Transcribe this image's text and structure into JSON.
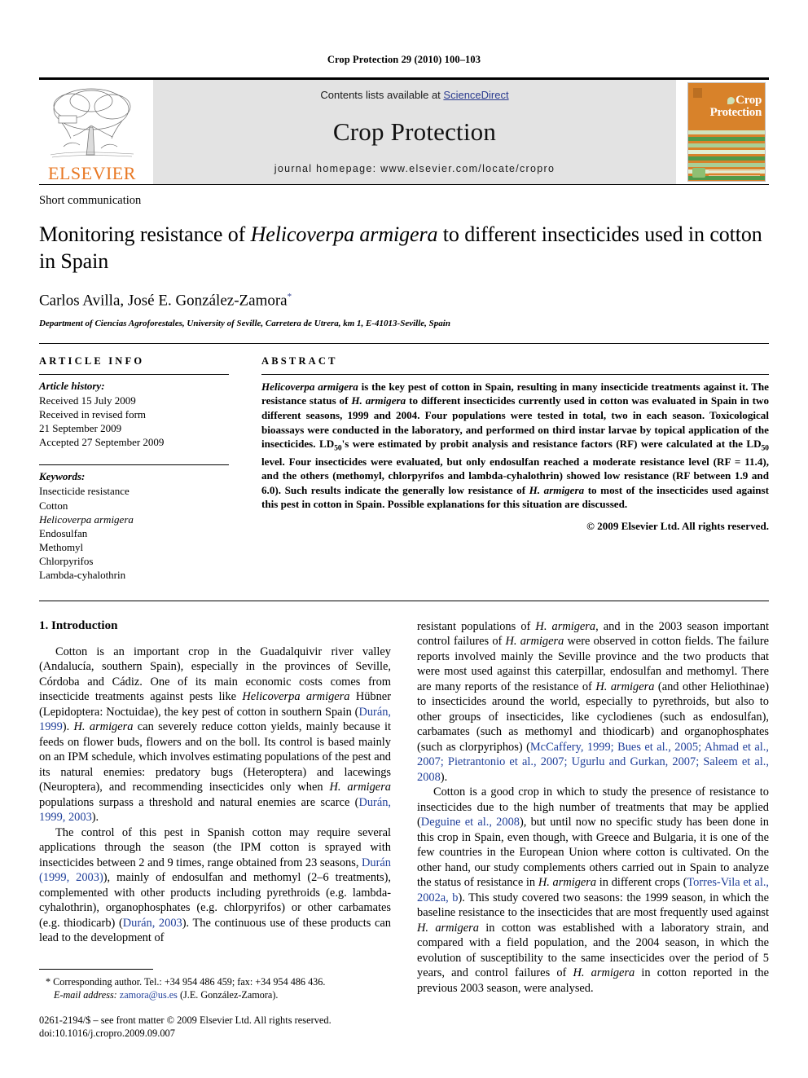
{
  "running_head": "Crop Protection 29 (2010) 100–103",
  "masthead": {
    "publisher_name": "ELSEVIER",
    "contents_prefix": "Contents lists available at ",
    "sciencedirect": "ScienceDirect",
    "journal_name": "Crop Protection",
    "homepage": "journal homepage: www.elsevier.com/locate/cropro",
    "cover_title_line1": "Crop",
    "cover_title_line2": "Protection",
    "accent_orange": "#E87722",
    "cover_orange": "#D8822A",
    "link_blue": "#2a3b8f",
    "band_gray": "#e3e3e3"
  },
  "article": {
    "doctype": "Short communication",
    "title_part1": "Monitoring resistance of ",
    "title_italic": "Helicoverpa armigera",
    "title_part2": " to different insecticides used in cotton in Spain",
    "authors": "Carlos Avilla, José E. González-Zamora",
    "corresponding_marker": "*",
    "affiliation": "Department of Ciencias Agroforestales, University of Seville, Carretera de Utrera, km 1, E-41013-Seville, Spain"
  },
  "info": {
    "heading": "ARTICLE INFO",
    "history_label": "Article history:",
    "history_lines": [
      "Received 15 July 2009",
      "Received in revised form",
      "21 September 2009",
      "Accepted 27 September 2009"
    ],
    "keywords_label": "Keywords:",
    "keywords": [
      "Insecticide resistance",
      "Cotton",
      "Helicoverpa armigera",
      "Endosulfan",
      "Methomyl",
      "Chlorpyrifos",
      "Lambda-cyhalothrin"
    ],
    "keyword_italic_index": 2
  },
  "abstract": {
    "heading": "ABSTRACT",
    "species": "Helicoverpa armigera",
    "species_short": "H. armigera",
    "text_1": " is the key pest of cotton in Spain, resulting in many insecticide treatments against it. The resistance status of ",
    "text_2": " to different insecticides currently used in cotton was evaluated in Spain in two different seasons, 1999 and 2004. Four populations were tested in total, two in each season. Toxicological bioassays were conducted in the laboratory, and performed on third instar larvae by topical application of the insecticides. LD",
    "sub_50_a": "50",
    "text_3": "'s were estimated by probit analysis and resistance factors (RF) were calculated at the LD",
    "sub_50_b": "50",
    "text_4": " level. Four insecticides were evaluated, but only endosulfan reached a moderate resistance level (RF = 11.4), and the others (methomyl, chlorpyrifos and lambda-cyhalothrin) showed low resistance (RF between 1.9 and 6.0). Such results indicate the generally low resistance of ",
    "text_5": " to most of the insecticides used against this pest in cotton in Spain. Possible explanations for this situation are discussed.",
    "copyright": "© 2009 Elsevier Ltd. All rights reserved."
  },
  "body": {
    "section_heading": "1. Introduction",
    "left_paragraphs": [
      {
        "runs": [
          {
            "t": "Cotton is an important crop in the Guadalquivir river valley (Andalucía, southern Spain), especially in the provinces of Seville, Córdoba and Cádiz. One of its main economic costs comes from insecticide treatments against pests like ",
            "s": "plain"
          },
          {
            "t": "Helicoverpa armigera",
            "s": "italic"
          },
          {
            "t": " Hübner (Lepidoptera: Noctuidae), the key pest of cotton in southern Spain (",
            "s": "plain"
          },
          {
            "t": "Durán, 1999",
            "s": "cite"
          },
          {
            "t": "). ",
            "s": "plain"
          },
          {
            "t": "H. armigera",
            "s": "italic"
          },
          {
            "t": " can severely reduce cotton yields, mainly because it feeds on flower buds, flowers and on the boll. Its control is based mainly on an IPM schedule, which involves estimating populations of the pest and its natural enemies: predatory bugs (Heteroptera) and lacewings (Neuroptera), and recommending insecticides only when ",
            "s": "plain"
          },
          {
            "t": "H. armigera",
            "s": "italic"
          },
          {
            "t": " populations surpass a threshold and natural enemies are scarce (",
            "s": "plain"
          },
          {
            "t": "Durán, 1999, 2003",
            "s": "cite"
          },
          {
            "t": ").",
            "s": "plain"
          }
        ]
      },
      {
        "runs": [
          {
            "t": "The control of this pest in Spanish cotton may require several applications through the season (the IPM cotton is sprayed with insecticides between 2 and 9 times, range obtained from 23 seasons, ",
            "s": "plain"
          },
          {
            "t": "Durán (1999, 2003)",
            "s": "cite"
          },
          {
            "t": "), mainly of endosulfan and methomyl (2–6 treatments), complemented with other products including pyrethroids (e.g. lambda-cyhalothrin), organophosphates (e.g. chlorpyrifos) or other carbamates (e.g. thiodicarb) (",
            "s": "plain"
          },
          {
            "t": "Durán, 2003",
            "s": "cite"
          },
          {
            "t": "). The continuous use of these products can lead to the development of",
            "s": "plain"
          }
        ]
      }
    ],
    "right_paragraphs": [
      {
        "indent": false,
        "runs": [
          {
            "t": "resistant populations of ",
            "s": "plain"
          },
          {
            "t": "H. armigera",
            "s": "italic"
          },
          {
            "t": ", and in the 2003 season important control failures of ",
            "s": "plain"
          },
          {
            "t": "H. armigera",
            "s": "italic"
          },
          {
            "t": " were observed in cotton fields. The failure reports involved mainly the Seville province and the two products that were most used against this caterpillar, endosulfan and methomyl. There are many reports of the resistance of ",
            "s": "plain"
          },
          {
            "t": "H. armigera",
            "s": "italic"
          },
          {
            "t": " (and other Heliothinae) to insecticides around the world, especially to pyrethroids, but also to other groups of insecticides, like cyclodienes (such as endosulfan), carbamates (such as methomyl and thiodicarb) and organophosphates (such as clorpyriphos) (",
            "s": "plain"
          },
          {
            "t": "McCaffery, 1999; Bues et al., 2005; Ahmad et al., 2007; Pietrantonio et al., 2007; Ugurlu and Gurkan, 2007; Saleem et al., 2008",
            "s": "cite"
          },
          {
            "t": ").",
            "s": "plain"
          }
        ]
      },
      {
        "indent": true,
        "runs": [
          {
            "t": "Cotton is a good crop in which to study the presence of resistance to insecticides due to the high number of treatments that may be applied (",
            "s": "plain"
          },
          {
            "t": "Deguine et al., 2008",
            "s": "cite"
          },
          {
            "t": "), but until now no specific study has been done in this crop in Spain, even though, with Greece and Bulgaria, it is one of the few countries in the European Union where cotton is cultivated. On the other hand, our study complements others carried out in Spain to analyze the status of resistance in ",
            "s": "plain"
          },
          {
            "t": "H. armigera",
            "s": "italic"
          },
          {
            "t": " in different crops (",
            "s": "plain"
          },
          {
            "t": "Torres-Vila et al., 2002a, b",
            "s": "cite"
          },
          {
            "t": "). This study covered two seasons: the 1999 season, in which the baseline resistance to the insecticides that are most frequently used against ",
            "s": "plain"
          },
          {
            "t": "H. armigera",
            "s": "italic"
          },
          {
            "t": " in cotton was established with a laboratory strain, and compared with a field population, and the 2004 season, in which the evolution of susceptibility to the same insecticides over the period of 5 years, and control failures of ",
            "s": "plain"
          },
          {
            "t": "H. armigera",
            "s": "italic"
          },
          {
            "t": " in cotton reported in the previous 2003 season, were analysed.",
            "s": "plain"
          }
        ]
      }
    ]
  },
  "footnote": {
    "corresponding": "* Corresponding author. Tel.: +34 954 486 459; fax: +34 954 486 436.",
    "email_label": "E-mail address:",
    "email": "zamora@us.es",
    "email_owner": "(J.E. González-Zamora).",
    "issn_line": "0261-2194/$ – see front matter © 2009 Elsevier Ltd. All rights reserved.",
    "doi_line": "doi:10.1016/j.cropro.2009.09.007"
  }
}
